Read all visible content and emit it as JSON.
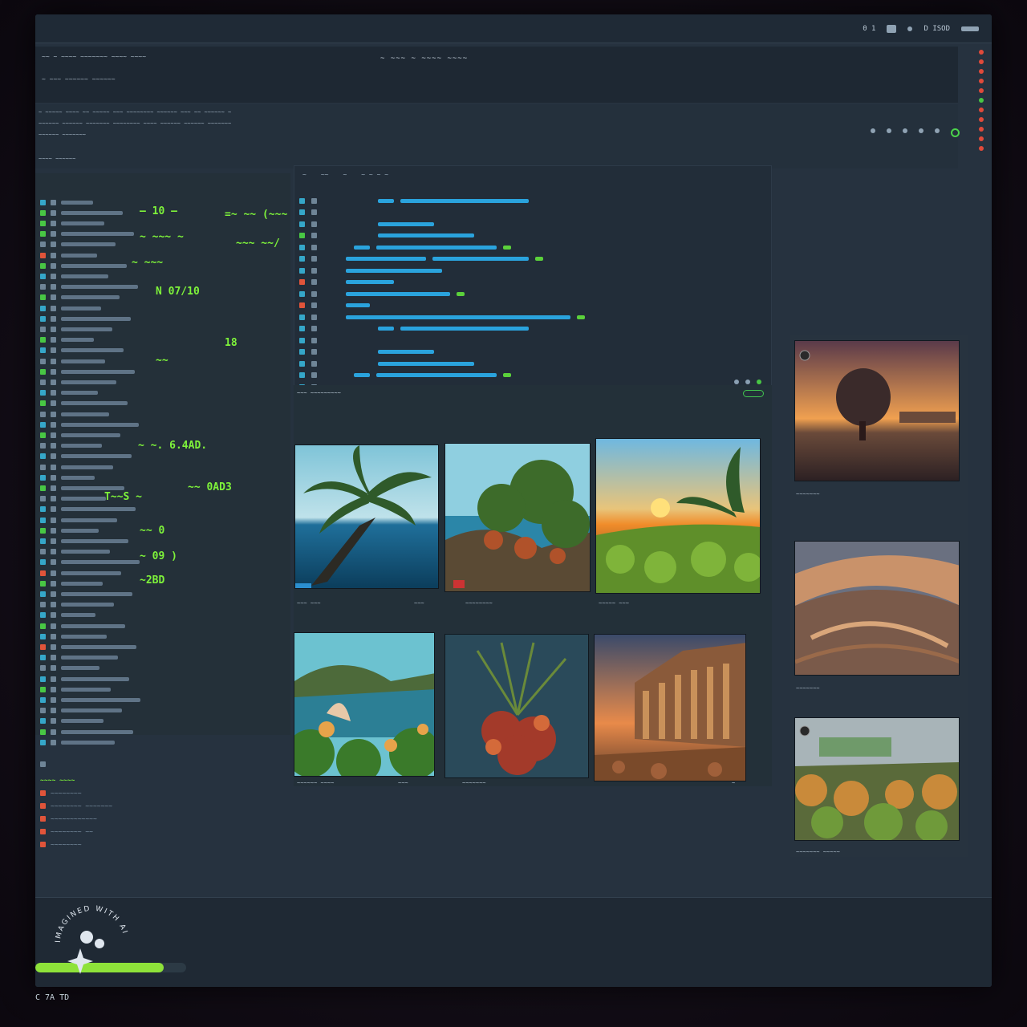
{
  "topbar": {
    "left_text": "0 1",
    "right_text": "D ISOD"
  },
  "menubar": {
    "title": "~ ~~~ ~ ~~~~ ~~~~",
    "line1": "~~ ~ ~~~~ ~~~~~~~ ~~~~ ~~~~",
    "line2": "~ ~~~ ~~~~~~ ~~~~~~"
  },
  "left_highlights": [
    "— 10 —",
    "=~ ~~ (~~~",
    "~ ~~~ ~",
    "~~~ ~~/",
    "~ ~~~",
    "N 07/10",
    "18",
    "~~",
    "~ ~. 6.4AD.",
    "T~~S ~",
    "~~ 0AD3",
    "~~ 0",
    "~ 09 )",
    "~2BD"
  ],
  "gallery": {
    "header": "~~~ ~~~~~~~~~",
    "captions_row1": [
      "~~~ ~~~",
      "~~~",
      "~~~~~~~~",
      "~~~~~ ~~~"
    ],
    "captions_row2": [
      "~~~~~~ ~~~~",
      "~~~",
      "~~~~~~~",
      "~"
    ]
  },
  "right_captions": [
    "~~~~~~~",
    "~~~~~~~",
    "~~~~~~~ ~~~~~"
  ],
  "status": {
    "text": "C 7A  TD",
    "progress_fraction": 0.85
  },
  "watermark": {
    "text": "IMAGINED WITH AI"
  },
  "colors": {
    "accent_green": "#7ef33a",
    "accent_blue": "#2aa3dd",
    "alert_red": "#e0543a"
  }
}
